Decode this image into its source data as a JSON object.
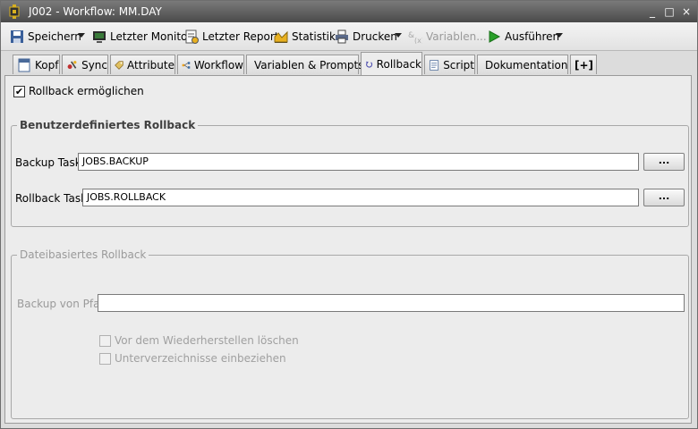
{
  "window": {
    "title": "J002 - Workflow: MM.DAY",
    "controls": [
      "_",
      "□",
      "×"
    ]
  },
  "toolbar": {
    "items": [
      {
        "label": "Speichern",
        "icon": "save-icon"
      },
      {
        "label": "Letzter Monitor",
        "icon": "monitor-icon"
      },
      {
        "label": "Letzter Report",
        "icon": "report-icon"
      },
      {
        "label": "Statistik",
        "icon": "chart-icon"
      },
      {
        "label": "Drucken",
        "icon": "print-icon"
      },
      {
        "label": "Variablen...",
        "icon": "variables-icon"
      },
      {
        "label": "Ausführen",
        "icon": "play-icon"
      }
    ]
  },
  "tabs": [
    {
      "label": "Kopf",
      "icon": "header-icon"
    },
    {
      "label": "Sync",
      "icon": "sync-icon"
    },
    {
      "label": "Attribute",
      "icon": "attribute-icon"
    },
    {
      "label": "Workflow",
      "icon": "workflow-icon"
    },
    {
      "label": "Variablen & Prompts",
      "icon": "variables-prompts-icon"
    },
    {
      "label": "Rollback",
      "icon": "rollback-icon",
      "active": true
    },
    {
      "label": "Script",
      "icon": "script-icon"
    },
    {
      "label": "Dokumentation",
      "icon": "documentation-icon"
    },
    {
      "label": "[+]",
      "icon": "add-tab-icon"
    }
  ],
  "rollback": {
    "enable_label": "Rollback ermöglichen",
    "enabled": true,
    "custom": {
      "title": "Benutzerdefiniertes Rollback",
      "backup_label": "Backup Task:",
      "backup_value": "JOBS.BACKUP",
      "rollback_label": "Rollback Task:",
      "rollback_value": "JOBS.ROLLBACK",
      "browse_label": "..."
    },
    "file": {
      "title": "Dateibasiertes Rollback",
      "path_label": "Backup von Pfad:",
      "path_value": "",
      "delete_before_restore_label": "Vor dem Wiederherstellen löschen",
      "include_subdirs_label": "Unterverzeichnisse einbeziehen"
    }
  },
  "colors": {
    "titlebar": "#5a5a5a",
    "play_green": "#2aa02a",
    "disabled_text": "#9a9a9a"
  }
}
